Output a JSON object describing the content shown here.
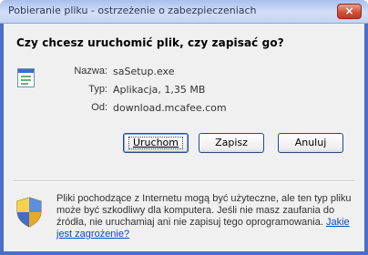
{
  "window": {
    "title": "Pobieranie pliku - ostrzeżenie o zabezpieczeniach",
    "close_label": "×"
  },
  "dialog": {
    "question": "Czy chcesz uruchomić plik, czy zapisać go?",
    "file": {
      "icon": "application-file-icon",
      "name_label": "Nazwa:",
      "name_value": "saSetup.exe",
      "type_label": "Typ:",
      "type_value": "Aplikacja, 1,35 MB",
      "from_label": "Od:",
      "from_value": "download.mcafee.com"
    },
    "buttons": {
      "run_label": "Uruchom",
      "save_label": "Zapisz",
      "cancel_label": "Anuluj"
    },
    "warning": {
      "icon": "security-shield-icon",
      "text": "Pliki pochodzące z Internetu mogą być użyteczne, ale ten typ pliku może być szkodliwy dla komputera. Jeśli nie masz zaufania do źródła, nie uruchamiaj ani nie zapisuj tego oprogramowania.",
      "link": "Jakie jest zagrożenie?"
    }
  },
  "colors": {
    "title_bar": "#c4d3f1",
    "close_button": "#cf4d33",
    "dialog_bg": "#f0f0f0",
    "link": "#0a48c4"
  }
}
